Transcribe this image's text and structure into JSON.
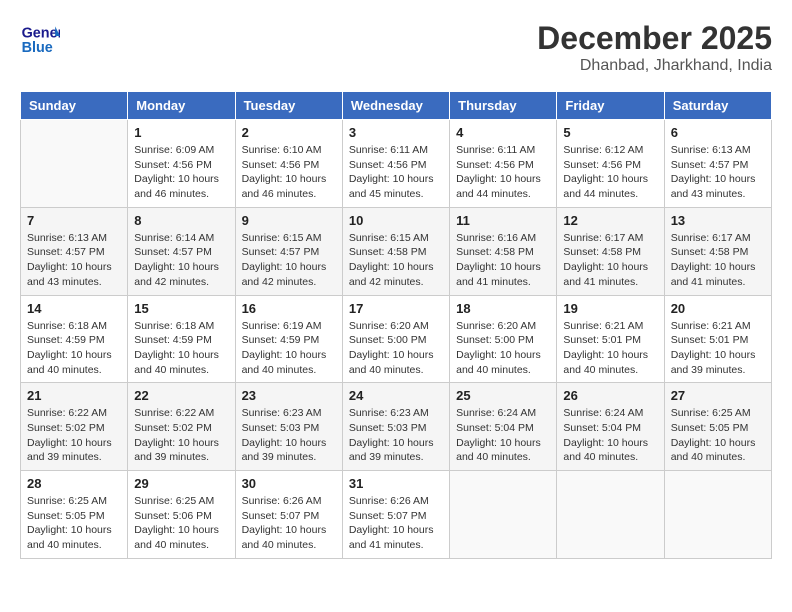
{
  "logo": {
    "line1": "General",
    "line2": "Blue"
  },
  "header": {
    "month_year": "December 2025",
    "location": "Dhanbad, Jharkhand, India"
  },
  "days_of_week": [
    "Sunday",
    "Monday",
    "Tuesday",
    "Wednesday",
    "Thursday",
    "Friday",
    "Saturday"
  ],
  "weeks": [
    [
      {
        "day": "",
        "info": ""
      },
      {
        "day": "1",
        "info": "Sunrise: 6:09 AM\nSunset: 4:56 PM\nDaylight: 10 hours and 46 minutes."
      },
      {
        "day": "2",
        "info": "Sunrise: 6:10 AM\nSunset: 4:56 PM\nDaylight: 10 hours and 46 minutes."
      },
      {
        "day": "3",
        "info": "Sunrise: 6:11 AM\nSunset: 4:56 PM\nDaylight: 10 hours and 45 minutes."
      },
      {
        "day": "4",
        "info": "Sunrise: 6:11 AM\nSunset: 4:56 PM\nDaylight: 10 hours and 44 minutes."
      },
      {
        "day": "5",
        "info": "Sunrise: 6:12 AM\nSunset: 4:56 PM\nDaylight: 10 hours and 44 minutes."
      },
      {
        "day": "6",
        "info": "Sunrise: 6:13 AM\nSunset: 4:57 PM\nDaylight: 10 hours and 43 minutes."
      }
    ],
    [
      {
        "day": "7",
        "info": "Sunrise: 6:13 AM\nSunset: 4:57 PM\nDaylight: 10 hours and 43 minutes."
      },
      {
        "day": "8",
        "info": "Sunrise: 6:14 AM\nSunset: 4:57 PM\nDaylight: 10 hours and 42 minutes."
      },
      {
        "day": "9",
        "info": "Sunrise: 6:15 AM\nSunset: 4:57 PM\nDaylight: 10 hours and 42 minutes."
      },
      {
        "day": "10",
        "info": "Sunrise: 6:15 AM\nSunset: 4:58 PM\nDaylight: 10 hours and 42 minutes."
      },
      {
        "day": "11",
        "info": "Sunrise: 6:16 AM\nSunset: 4:58 PM\nDaylight: 10 hours and 41 minutes."
      },
      {
        "day": "12",
        "info": "Sunrise: 6:17 AM\nSunset: 4:58 PM\nDaylight: 10 hours and 41 minutes."
      },
      {
        "day": "13",
        "info": "Sunrise: 6:17 AM\nSunset: 4:58 PM\nDaylight: 10 hours and 41 minutes."
      }
    ],
    [
      {
        "day": "14",
        "info": "Sunrise: 6:18 AM\nSunset: 4:59 PM\nDaylight: 10 hours and 40 minutes."
      },
      {
        "day": "15",
        "info": "Sunrise: 6:18 AM\nSunset: 4:59 PM\nDaylight: 10 hours and 40 minutes."
      },
      {
        "day": "16",
        "info": "Sunrise: 6:19 AM\nSunset: 4:59 PM\nDaylight: 10 hours and 40 minutes."
      },
      {
        "day": "17",
        "info": "Sunrise: 6:20 AM\nSunset: 5:00 PM\nDaylight: 10 hours and 40 minutes."
      },
      {
        "day": "18",
        "info": "Sunrise: 6:20 AM\nSunset: 5:00 PM\nDaylight: 10 hours and 40 minutes."
      },
      {
        "day": "19",
        "info": "Sunrise: 6:21 AM\nSunset: 5:01 PM\nDaylight: 10 hours and 40 minutes."
      },
      {
        "day": "20",
        "info": "Sunrise: 6:21 AM\nSunset: 5:01 PM\nDaylight: 10 hours and 39 minutes."
      }
    ],
    [
      {
        "day": "21",
        "info": "Sunrise: 6:22 AM\nSunset: 5:02 PM\nDaylight: 10 hours and 39 minutes."
      },
      {
        "day": "22",
        "info": "Sunrise: 6:22 AM\nSunset: 5:02 PM\nDaylight: 10 hours and 39 minutes."
      },
      {
        "day": "23",
        "info": "Sunrise: 6:23 AM\nSunset: 5:03 PM\nDaylight: 10 hours and 39 minutes."
      },
      {
        "day": "24",
        "info": "Sunrise: 6:23 AM\nSunset: 5:03 PM\nDaylight: 10 hours and 39 minutes."
      },
      {
        "day": "25",
        "info": "Sunrise: 6:24 AM\nSunset: 5:04 PM\nDaylight: 10 hours and 40 minutes."
      },
      {
        "day": "26",
        "info": "Sunrise: 6:24 AM\nSunset: 5:04 PM\nDaylight: 10 hours and 40 minutes."
      },
      {
        "day": "27",
        "info": "Sunrise: 6:25 AM\nSunset: 5:05 PM\nDaylight: 10 hours and 40 minutes."
      }
    ],
    [
      {
        "day": "28",
        "info": "Sunrise: 6:25 AM\nSunset: 5:05 PM\nDaylight: 10 hours and 40 minutes."
      },
      {
        "day": "29",
        "info": "Sunrise: 6:25 AM\nSunset: 5:06 PM\nDaylight: 10 hours and 40 minutes."
      },
      {
        "day": "30",
        "info": "Sunrise: 6:26 AM\nSunset: 5:07 PM\nDaylight: 10 hours and 40 minutes."
      },
      {
        "day": "31",
        "info": "Sunrise: 6:26 AM\nSunset: 5:07 PM\nDaylight: 10 hours and 41 minutes."
      },
      {
        "day": "",
        "info": ""
      },
      {
        "day": "",
        "info": ""
      },
      {
        "day": "",
        "info": ""
      }
    ]
  ]
}
